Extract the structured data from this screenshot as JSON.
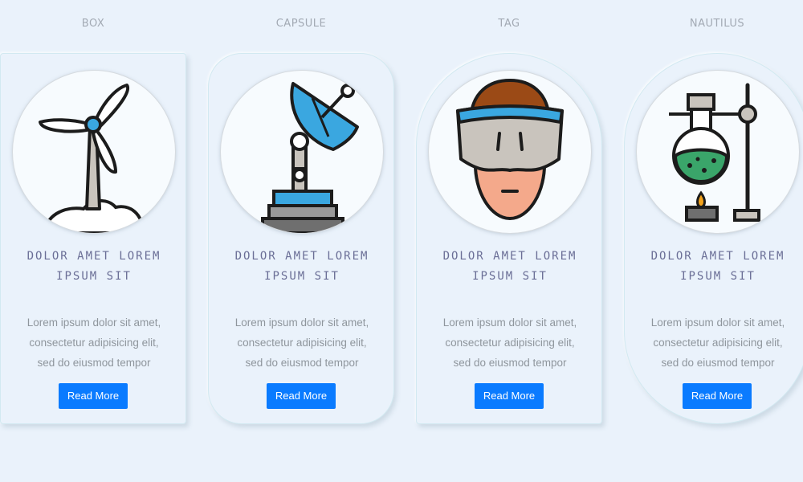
{
  "cards": [
    {
      "label": "BOX",
      "icon": "wind-turbine-icon",
      "title": "DOLOR AMET LOREM\nIPSUM SIT",
      "text": "Lorem ipsum dolor sit amet,\nconsectetur adipisicing elit,\nsed do eiusmod tempor",
      "button": "Read More"
    },
    {
      "label": "CAPSULE",
      "icon": "satellite-dish-icon",
      "title": "DOLOR AMET LOREM\nIPSUM SIT",
      "text": "Lorem ipsum dolor sit amet,\nconsectetur adipisicing elit,\nsed do eiusmod tempor",
      "button": "Read More"
    },
    {
      "label": "TAG",
      "icon": "vr-headset-person-icon",
      "title": "DOLOR AMET LOREM\nIPSUM SIT",
      "text": "Lorem ipsum dolor sit amet,\nconsectetur adipisicing elit,\nsed do eiusmod tempor",
      "button": "Read More"
    },
    {
      "label": "NAUTILUS",
      "icon": "chemistry-flask-burner-icon",
      "title": "DOLOR AMET LOREM\nIPSUM SIT",
      "text": "Lorem ipsum dolor sit amet,\nconsectetur adipisicing elit,\nsed do eiusmod tempor",
      "button": "Read More"
    }
  ],
  "colors": {
    "background": "#eaf2fb",
    "accent": "#0a7bff",
    "title": "#6a6e96",
    "body_text": "#8f969d",
    "label": "#a3aab4"
  }
}
